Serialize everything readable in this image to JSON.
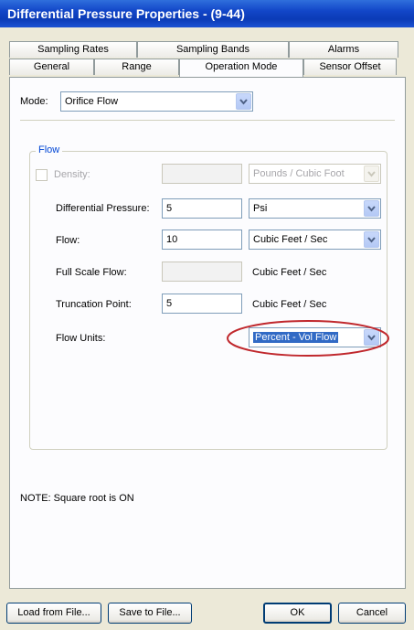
{
  "window": {
    "title": "Differential Pressure Properties -  (9-44)"
  },
  "tabs": {
    "row1": [
      "Sampling Rates",
      "Sampling Bands",
      "Alarms"
    ],
    "row2": [
      "General",
      "Range",
      "Operation Mode",
      "Sensor Offset"
    ],
    "active": "Operation Mode"
  },
  "mode": {
    "label": "Mode:",
    "value": "Orifice Flow"
  },
  "flow_group": {
    "title": "Flow",
    "density": {
      "label": "Density:",
      "value": "",
      "unit": "Pounds / Cubic Foot",
      "checked": false
    },
    "differential_pressure": {
      "label": "Differential Pressure:",
      "value": "5",
      "unit": "Psi"
    },
    "flow": {
      "label": "Flow:",
      "value": "10",
      "unit": "Cubic Feet / Sec"
    },
    "full_scale_flow": {
      "label": "Full Scale Flow:",
      "value": "",
      "unit": "Cubic Feet / Sec"
    },
    "truncation_point": {
      "label": "Truncation Point:",
      "value": "5",
      "unit": "Cubic Feet / Sec"
    },
    "flow_units": {
      "label": "Flow Units:",
      "value": "Percent - Vol Flow"
    }
  },
  "note": "NOTE: Square root is ON",
  "buttons": {
    "load": "Load from File...",
    "save": "Save to File...",
    "ok": "OK",
    "cancel": "Cancel"
  },
  "colors": {
    "highlight_ellipse": "#c0282d",
    "group_title": "#0046d5",
    "titlebar": "#0b3bb6"
  }
}
